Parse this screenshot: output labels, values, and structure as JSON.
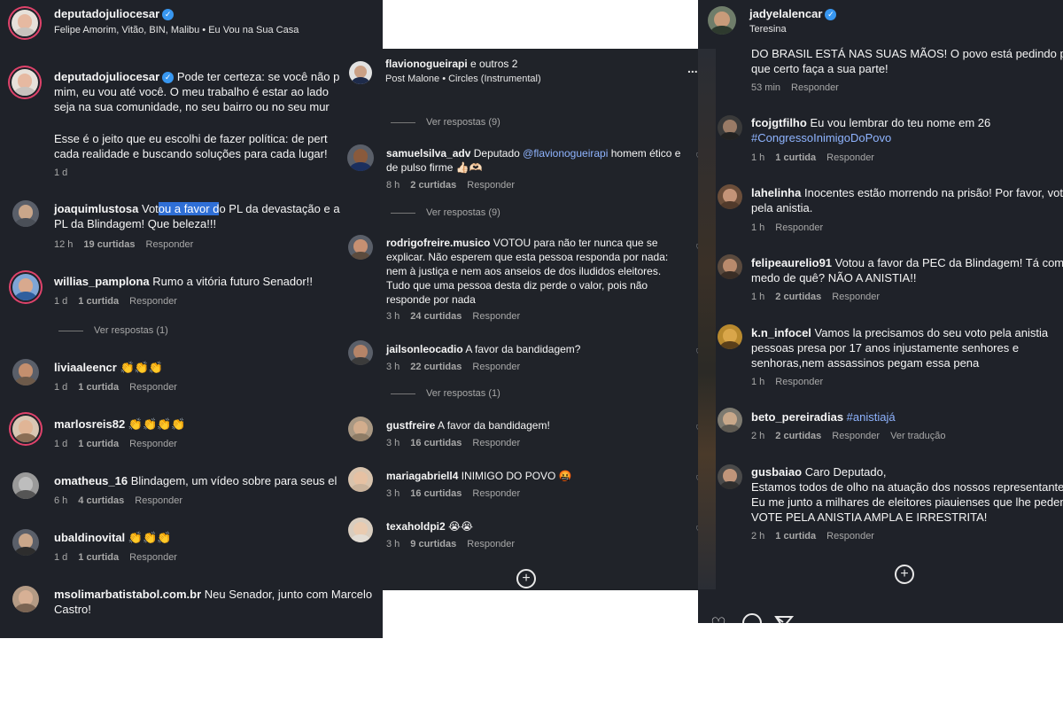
{
  "panel1": {
    "header": {
      "username": "deputadojuliocesar",
      "subtitle": "Felipe Amorim, Vitão, BIN, Malibu • Eu Vou na Sua Casa"
    },
    "caption": {
      "username": "deputadojuliocesar",
      "line1": "Pode ter certeza: se você não p",
      "line2": "mim, eu vou até você. O meu trabalho é estar ao lado",
      "line3": "seja na sua comunidade, no seu bairro ou no seu mur",
      "line4": "Esse é o jeito que eu escolhi de fazer política: de pert",
      "line5": "cada realidade e buscando soluções para cada lugar!",
      "time": "1 d"
    },
    "comments": [
      {
        "username": "joaquimlustosa",
        "text_pre": "Vot",
        "text_sel": "ou a favor d",
        "text_post": "o PL da devastação e a",
        "text2": "PL da Blindagem! Que beleza!!!",
        "time": "12 h",
        "likes": "19 curtidas",
        "reply": "Responder"
      },
      {
        "username": "willias_pamplona",
        "text": "Rumo a vitória futuro Senador!!",
        "time": "1 d",
        "likes": "1 curtida",
        "reply": "Responder",
        "view_replies": "Ver respostas (1)"
      },
      {
        "username": "liviaaleencr",
        "text": "👏👏👏",
        "time": "1 d",
        "likes": "1 curtida",
        "reply": "Responder"
      },
      {
        "username": "marlosreis82",
        "text": "👏👏👏👏",
        "time": "1 d",
        "likes": "1 curtida",
        "reply": "Responder"
      },
      {
        "username": "omatheus_16",
        "text": "Blindagem, um vídeo sobre para seus el",
        "time": "6 h",
        "likes": "4 curtidas",
        "reply": "Responder"
      },
      {
        "username": "ubaldinovital",
        "text": "👏👏👏",
        "time": "1 d",
        "likes": "1 curtida",
        "reply": "Responder"
      },
      {
        "username": "msolimarbatistabol.com.br",
        "text": "Neu Senador, junto com Marcelo",
        "text2": "Castro!"
      }
    ]
  },
  "panel2": {
    "header": {
      "username": "flavionogueirapi",
      "others": "e outros 2",
      "song": "Post Malone • Circles (Instrumental)",
      "more": "..."
    },
    "view_replies_top": "Ver respostas (9)",
    "comments": [
      {
        "username": "samuelsilva_adv",
        "text_pre": "Deputado",
        "mention": "@flavionogueirapi",
        "text_post": "homem ético e",
        "text2": "de pulso firme 👍🏻🫶🏻",
        "time": "8 h",
        "likes": "2 curtidas",
        "reply": "Responder",
        "view_replies": "Ver respostas (9)"
      },
      {
        "username": "rodrigofreire.musico",
        "text": "VOTOU para não ter nunca que se",
        "text2": "explicar. Não esperem que esta pessoa responda por nada:",
        "text3": "nem à justiça e nem aos anseios de dos iludidos eleitores.",
        "text4": "Tudo que uma pessoa desta diz perde o valor, pois não",
        "text5": "responde por nada",
        "time": "3 h",
        "likes": "24 curtidas",
        "reply": "Responder"
      },
      {
        "username": "jailsonleocadio",
        "text": "A favor da bandidagem?",
        "time": "3 h",
        "likes": "22 curtidas",
        "reply": "Responder",
        "view_replies": "Ver respostas (1)"
      },
      {
        "username": "gustfreire",
        "text": "A favor da bandidagem!",
        "time": "3 h",
        "likes": "16 curtidas",
        "reply": "Responder"
      },
      {
        "username": "mariagabriell4",
        "text": "INIMIGO DO POVO 🤬",
        "time": "3 h",
        "likes": "16 curtidas",
        "reply": "Responder"
      },
      {
        "username": "texaholdpi2",
        "text": "😭😭",
        "time": "3 h",
        "likes": "9 curtidas",
        "reply": "Responder"
      }
    ]
  },
  "panel3": {
    "header": {
      "username": "jadyelalencar",
      "subtitle": "Teresina"
    },
    "top_text1": "DO BRASIL ESTÁ NAS SUAS MÃOS! O povo está pedindo pelo",
    "top_text2": "que certo faça a sua parte!",
    "top_time": "53 min",
    "top_reply": "Responder",
    "comments": [
      {
        "username": "fcojgtfilho",
        "text": "Eu vou lembrar do teu nome em 26",
        "hashtag": "#CongressoInimigoDoPovo",
        "time": "1 h",
        "likes": "1 curtida",
        "reply": "Responder"
      },
      {
        "username": "lahelinha",
        "text": "Inocentes estão morrendo na prisão! Por favor, vote",
        "text2": "pela anistia.",
        "time": "1 h",
        "reply": "Responder"
      },
      {
        "username": "felipeaurelio91",
        "text": "Votou a favor da PEC da Blindagem! Tá com",
        "text2": "medo de quê? NÃO A ANISTIA!!",
        "time": "1 h",
        "likes": "2 curtidas",
        "reply": "Responder"
      },
      {
        "username": "k.n_infocel",
        "text": "Vamos la precisamos do seu voto pela anistia",
        "text2": "pessoas presa por 17 anos injustamente senhores e",
        "text3": "senhoras,nem assassinos pegam essa pena",
        "time": "1 h",
        "reply": "Responder"
      },
      {
        "username": "beto_pereiradias",
        "hashtag": "#anistiajá",
        "time": "2 h",
        "likes": "2 curtidas",
        "reply": "Responder",
        "translate": "Ver tradução"
      },
      {
        "username": "gusbaiao",
        "text": "Caro Deputado,",
        "text2": "Estamos todos de olho na atuação dos nossos representantes.",
        "text3": "Eu me junto a milhares de eleitores piauienses que lhe pedem:",
        "text4": "VOTE PELA ANISTIA AMPLA E IRRESTRITA!",
        "time": "2 h",
        "likes": "1 curtida",
        "reply": "Responder"
      }
    ]
  },
  "colors": {
    "background": "#1f2229",
    "verified": "#3897f0",
    "hashtag": "#8fb4ff",
    "story_ring": "#e0436b",
    "selection": "#2f6fd6"
  }
}
